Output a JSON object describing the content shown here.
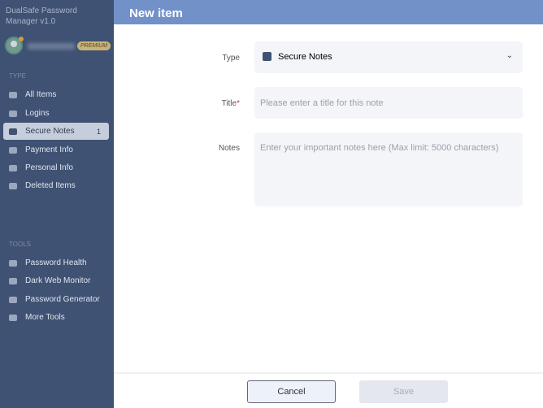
{
  "app": {
    "title": "DualSafe Password Manager v1.0",
    "badge": "PREMIUM"
  },
  "sidebar": {
    "type_section": "TYPE",
    "type_items": [
      {
        "label": "All Items"
      },
      {
        "label": "Logins"
      },
      {
        "label": "Secure Notes",
        "count": "1"
      },
      {
        "label": "Payment Info"
      },
      {
        "label": "Personal Info"
      },
      {
        "label": "Deleted Items"
      }
    ],
    "tools_section": "TOOLS",
    "tool_items": [
      {
        "label": "Password Health"
      },
      {
        "label": "Dark Web Monitor"
      },
      {
        "label": "Password Generator"
      },
      {
        "label": "More Tools"
      }
    ]
  },
  "header": {
    "title": "New item"
  },
  "form": {
    "type_label": "Type",
    "type_value": "Secure Notes",
    "title_label": "Title",
    "required_mark": "*",
    "title_placeholder": "Please enter a title for this note",
    "notes_label": "Notes",
    "notes_placeholder": "Enter your important notes here (Max limit: 5000 characters)"
  },
  "footer": {
    "cancel": "Cancel",
    "save": "Save"
  }
}
